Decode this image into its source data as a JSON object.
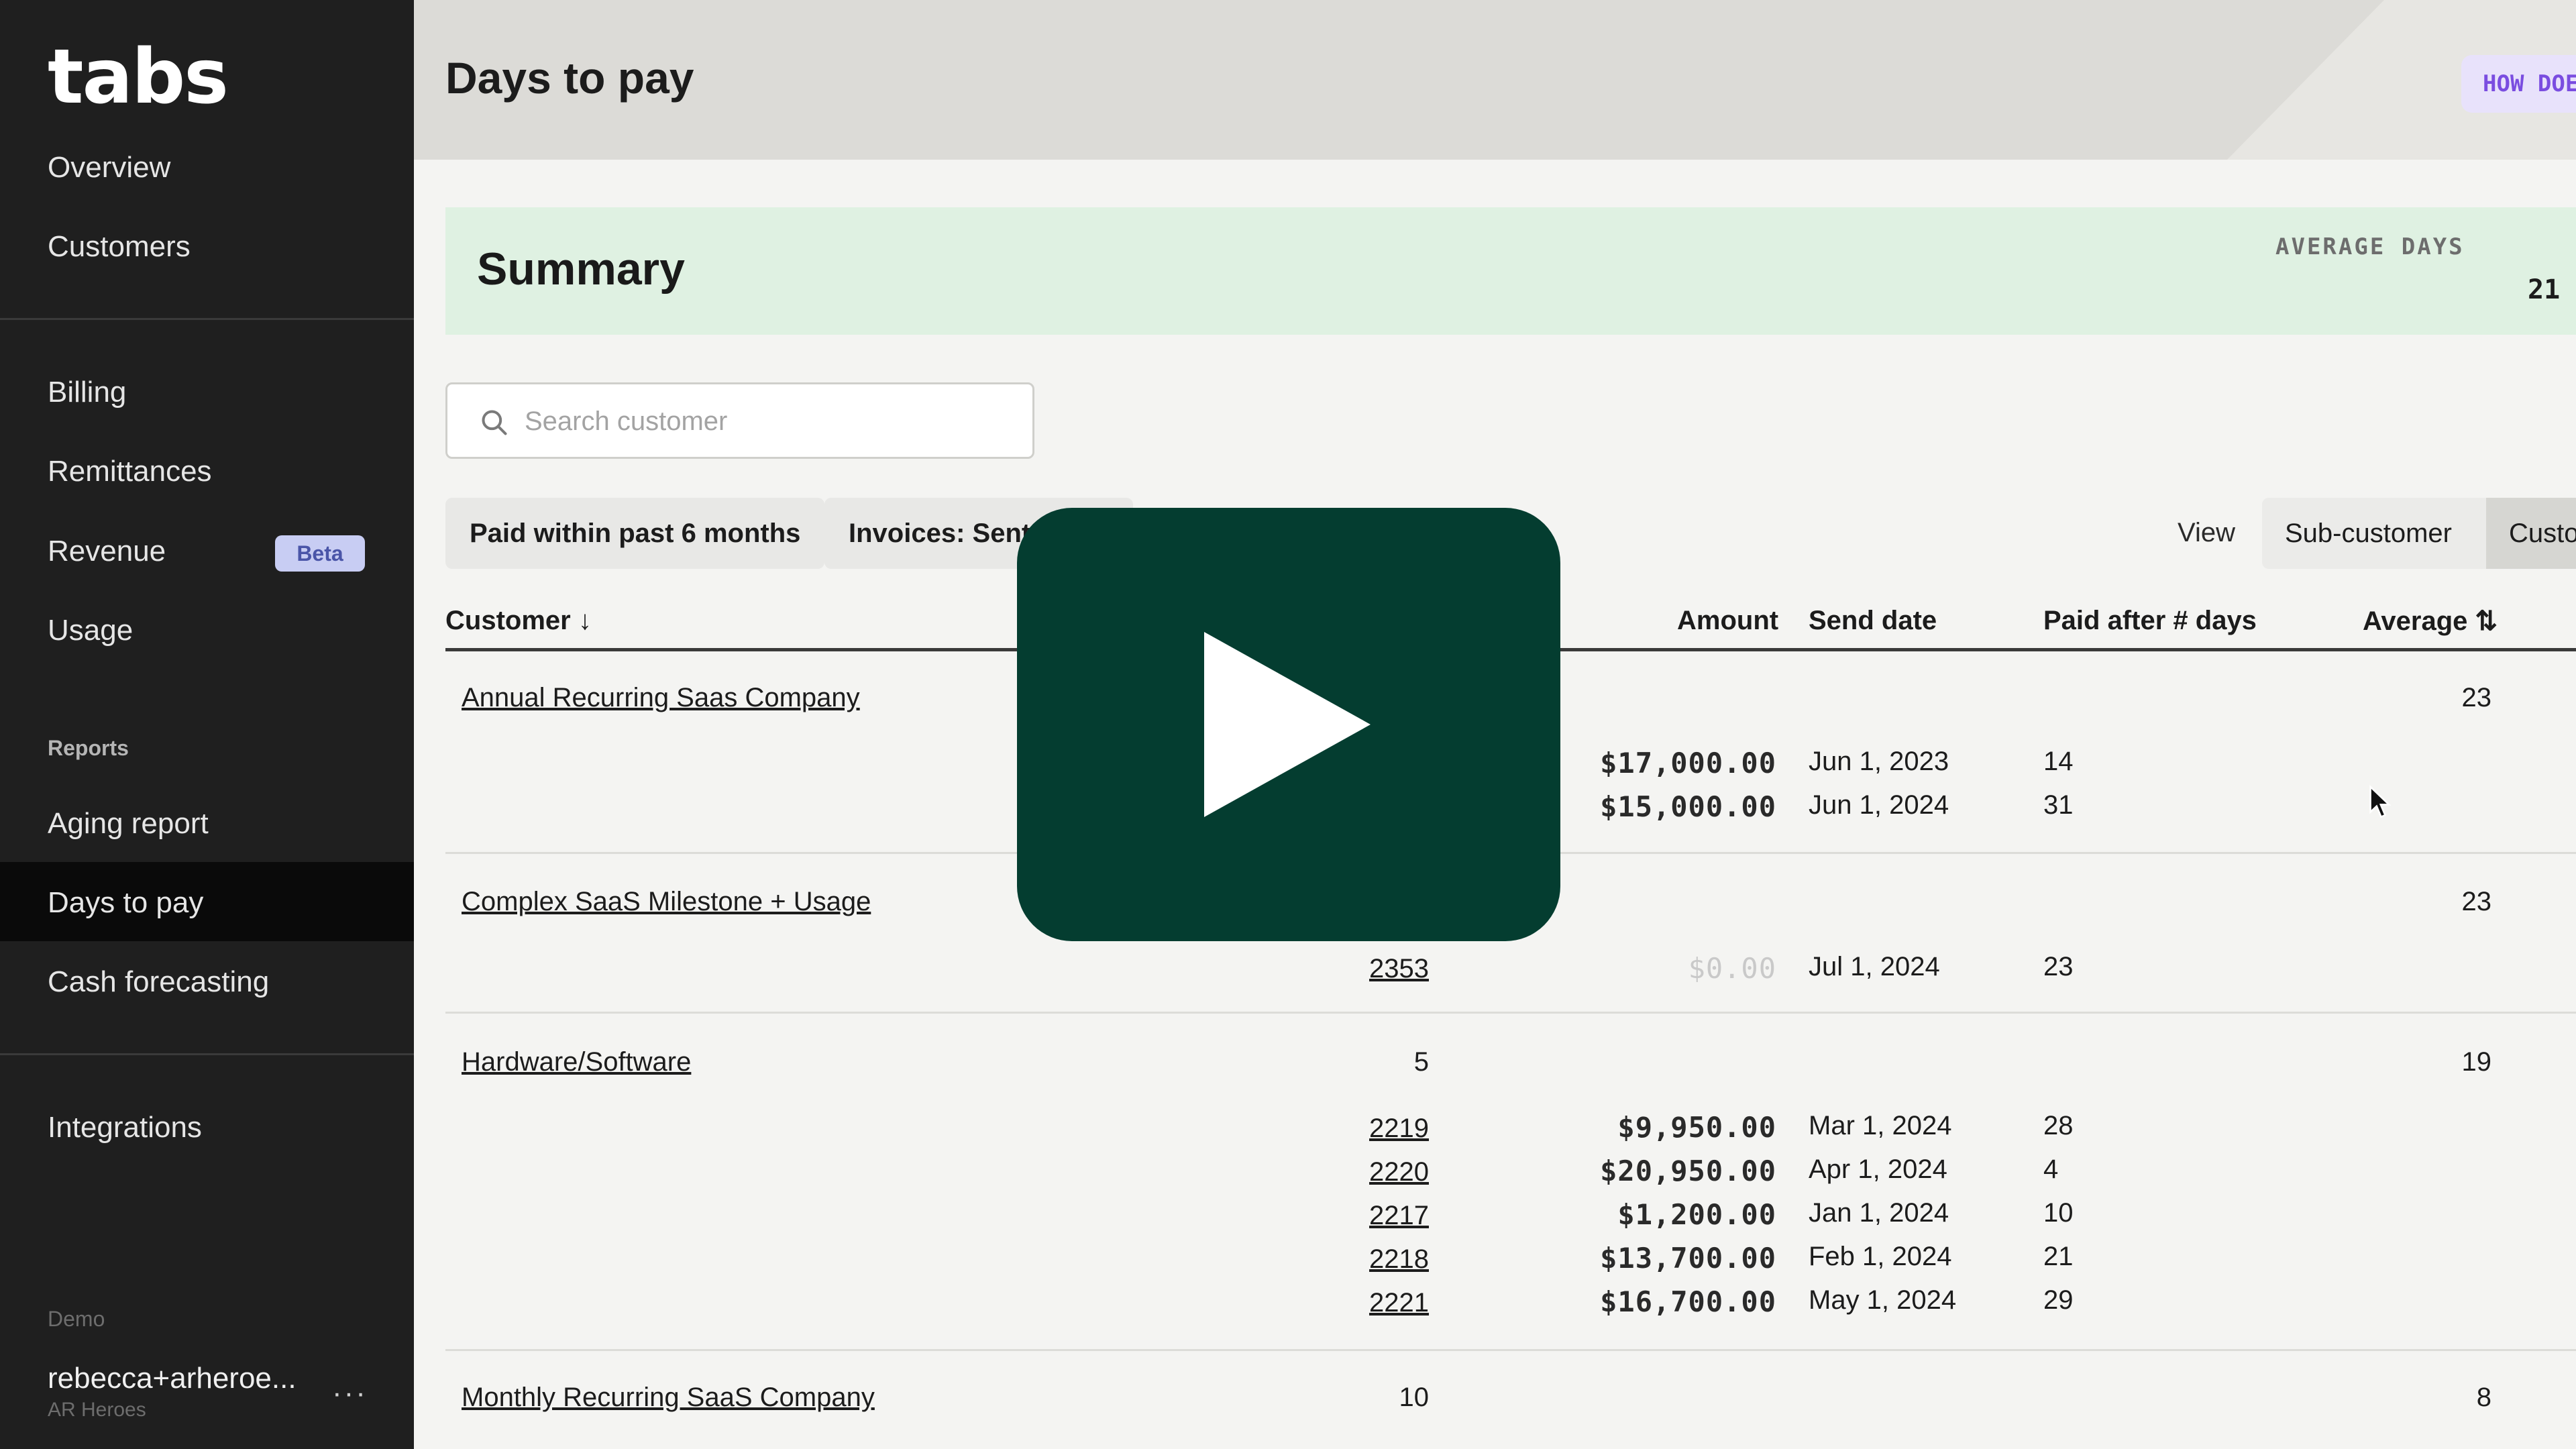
{
  "app": {
    "logo": "tabs"
  },
  "sidebar": {
    "overview": "Overview",
    "customers": "Customers",
    "billing": "Billing",
    "remittances": "Remittances",
    "revenue": "Revenue",
    "beta": "Beta",
    "usage": "Usage",
    "reports_label": "Reports",
    "aging_report": "Aging report",
    "days_to_pay": "Days to pay",
    "cash_forecasting": "Cash forecasting",
    "integrations": "Integrations",
    "demo_label": "Demo",
    "user_name": "rebecca+arheroe...",
    "user_org": "AR Heroes",
    "more": "···"
  },
  "header": {
    "title": "Days to pay",
    "how_button": "HOW DOES"
  },
  "summary": {
    "title": "Summary",
    "avg_label": "AVERAGE DAYS",
    "avg_value": "21"
  },
  "search": {
    "placeholder": "Search customer",
    "value": ""
  },
  "filters": {
    "paid_within": "Paid within past 6 months",
    "invoices": "Invoices: Sent h"
  },
  "view": {
    "label": "View",
    "sub_customer": "Sub-customer",
    "customer": "Customer"
  },
  "table": {
    "columns": {
      "customer": "Customer ↓",
      "amount": "Amount",
      "send_date": "Send date",
      "paid_after": "Paid after # days",
      "average": "Average ⇅"
    },
    "groups": [
      {
        "name": "Annual Recurring Saas Company",
        "count": "",
        "average": "23",
        "invoices": [
          {
            "id": "",
            "amount": "$17,000.00",
            "date": "Jun 1, 2023",
            "days": "14"
          },
          {
            "id": "",
            "amount": "$15,000.00",
            "date": "Jun 1, 2024",
            "days": "31"
          }
        ]
      },
      {
        "name": "Complex SaaS Milestone + Usage",
        "count": "",
        "average": "23",
        "invoices": [
          {
            "id": "2353",
            "amount": "$0.00",
            "date": "Jul 1, 2024",
            "days": "23"
          }
        ]
      },
      {
        "name": "Hardware/Software",
        "count": "5",
        "average": "19",
        "invoices": [
          {
            "id": "2219",
            "amount": "$9,950.00",
            "date": "Mar 1, 2024",
            "days": "28"
          },
          {
            "id": "2220",
            "amount": "$20,950.00",
            "date": "Apr 1, 2024",
            "days": "4"
          },
          {
            "id": "2217",
            "amount": "$1,200.00",
            "date": "Jan 1, 2024",
            "days": "10"
          },
          {
            "id": "2218",
            "amount": "$13,700.00",
            "date": "Feb 1, 2024",
            "days": "21"
          },
          {
            "id": "2221",
            "amount": "$16,700.00",
            "date": "May 1, 2024",
            "days": "29"
          }
        ]
      },
      {
        "name": "Monthly Recurring SaaS Company",
        "count": "10",
        "average": "8",
        "invoices": []
      }
    ]
  },
  "colors": {
    "sidebar_bg": "#1f1f1f",
    "summary_bg": "#dff1e2",
    "play_bg": "#043d30",
    "beta_bg": "#c8cdf3"
  },
  "icons": {
    "search": "search-icon",
    "play": "play-icon",
    "cursor": "mouse-pointer-icon"
  }
}
